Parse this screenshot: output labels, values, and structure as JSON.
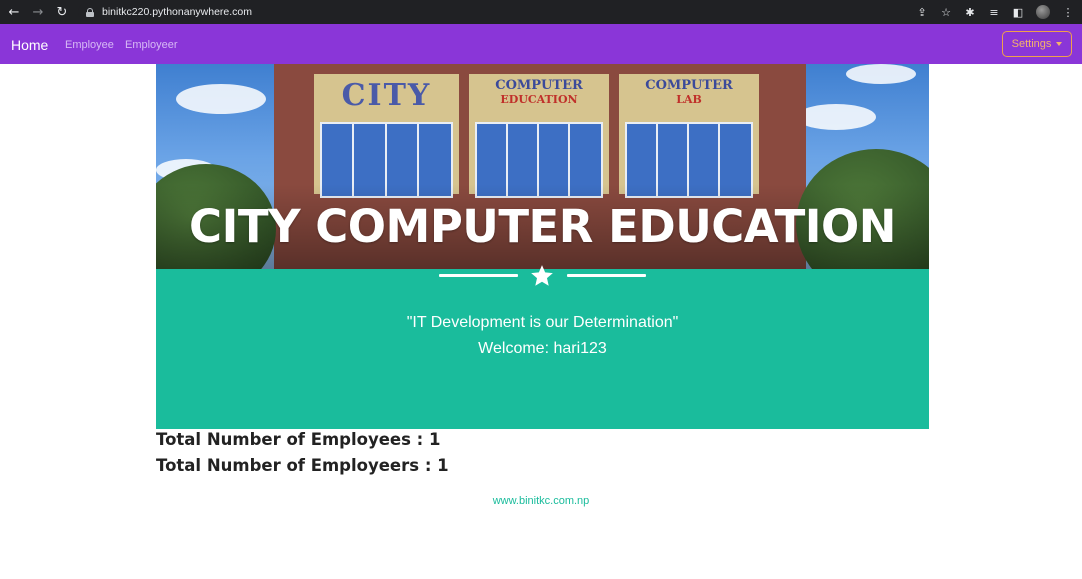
{
  "browser": {
    "url": "binitkc220.pythonanywhere.com"
  },
  "navbar": {
    "brand": "Home",
    "links": [
      "Employee",
      "Employeer"
    ],
    "settings_label": "Settings"
  },
  "hero": {
    "title": "CITY COMPUTER EDUCATION",
    "sign_left": "CITY",
    "sign_mid_top": "COMPUTER",
    "sign_mid_bottom": "EDUCATION",
    "sign_right_top": "COMPUTER",
    "sign_right_bottom": "LAB"
  },
  "banner": {
    "tagline": "\"IT Development is our Determination\"",
    "welcome": "Welcome: hari123"
  },
  "stats": {
    "employees": "Total Number of Employees : 1",
    "employeers": "Total Number of Employeers : 1"
  },
  "footer": {
    "link": "www.binitkc.com.np"
  },
  "colors": {
    "navbar": "#8a36d8",
    "accent_teal": "#1abc9c",
    "settings_border": "#f0a04b"
  }
}
